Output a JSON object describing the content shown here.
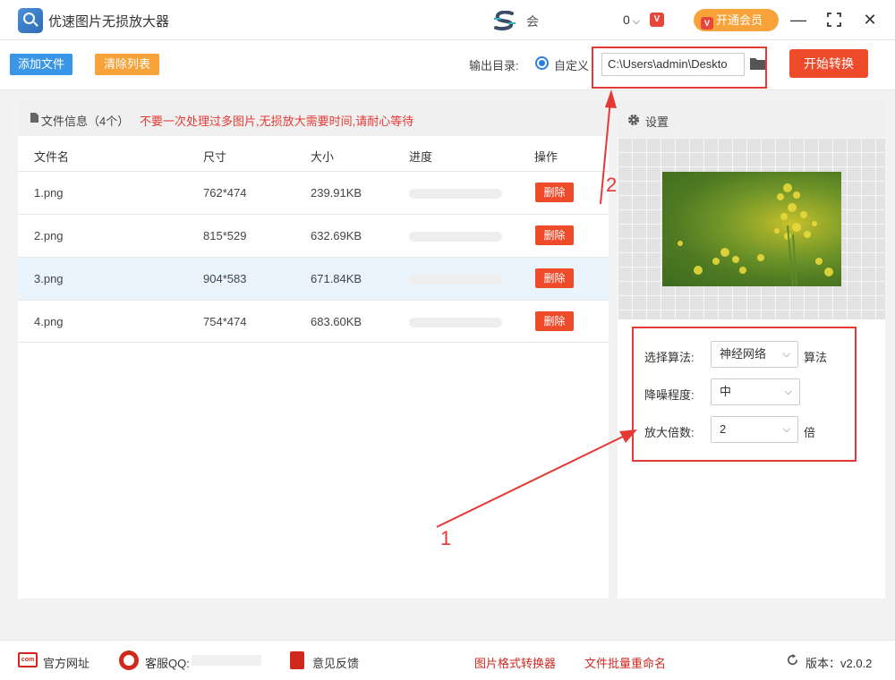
{
  "app": {
    "title": "优速图片无损放大器",
    "user_label": "会",
    "points": "0",
    "vip_button": "开通会员",
    "vip_icon_letter": "V"
  },
  "toolbar": {
    "add_files": "添加文件",
    "clear_list": "清除列表",
    "output_label": "输出目录:",
    "radio_custom": "自定义",
    "output_path": "C:\\Users\\admin\\Deskto",
    "start_button": "开始转换"
  },
  "file_panel": {
    "info_label": "文件信息（4个）",
    "warning": "不要一次处理过多图片,无损放大需要时间,请耐心等待",
    "columns": [
      "文件名",
      "尺寸",
      "大小",
      "进度",
      "操作"
    ],
    "rows": [
      {
        "name": "1.png",
        "size": "762*474",
        "filesize": "239.91KB",
        "progress": 0,
        "action": "删除"
      },
      {
        "name": "2.png",
        "size": "815*529",
        "filesize": "632.69KB",
        "progress": 0,
        "action": "删除"
      },
      {
        "name": "3.png",
        "size": "904*583",
        "filesize": "671.84KB",
        "progress": 0,
        "action": "删除"
      },
      {
        "name": "4.png",
        "size": "754*474",
        "filesize": "683.60KB",
        "progress": 0,
        "action": "删除"
      }
    ],
    "selected_row": 2
  },
  "settings": {
    "title": "设置",
    "algorithm_label": "选择算法:",
    "algorithm_value": "神经网络",
    "algorithm_suffix": "算法",
    "denoise_label": "降噪程度:",
    "denoise_value": "中",
    "scale_label": "放大倍数:",
    "scale_value": "2",
    "scale_suffix": "倍"
  },
  "footer": {
    "website": "官方网址",
    "com_icon_text": "com",
    "qq_label": "客服QQ:",
    "feedback": "意见反馈",
    "format_converter": "图片格式转换器",
    "batch_rename": "文件批量重命名",
    "version": "版本：v2.0.2"
  },
  "annotations": {
    "num1": "1",
    "num2": "2"
  },
  "colors": {
    "accent_blue": "#3a97e8",
    "accent_orange": "#f8a23a",
    "accent_red": "#ee4b2b",
    "annotation_red": "#e53935"
  }
}
